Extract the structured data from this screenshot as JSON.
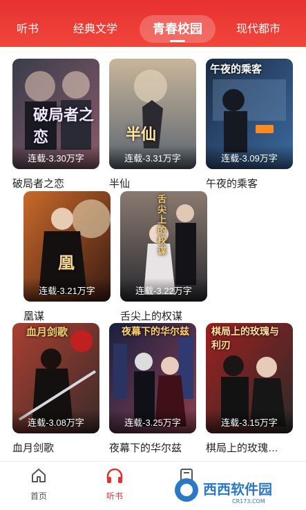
{
  "tabs": [
    {
      "label": "听书"
    },
    {
      "label": "经典文学"
    },
    {
      "label": "青春校园"
    },
    {
      "label": "现代都市"
    }
  ],
  "active_tab": "青春校园",
  "books": [
    {
      "title": "破局者之恋",
      "badge": "连载-3.30万字",
      "cover_text": "破局者之恋",
      "cover_colors": [
        "#3a3d4a",
        "#8a5a6a"
      ]
    },
    {
      "title": "半仙",
      "badge": "连载-3.31万字",
      "cover_text": "半仙",
      "cover_colors": [
        "#5a6470",
        "#c9b59a"
      ]
    },
    {
      "title": "午夜的乘客",
      "badge": "连载-3.09万字",
      "cover_text": "午夜的乘客",
      "cover_colors": [
        "#1c2c44",
        "#3b6aa0"
      ]
    },
    {
      "title": "凰谋",
      "badge": "连载-3.21万字",
      "cover_text": "凰",
      "cover_colors": [
        "#3a1a12",
        "#c96a2a"
      ]
    },
    {
      "title": "舌尖上的权谋",
      "badge": "连载-3.22万字",
      "cover_text": "舌尖上的权谋",
      "cover_colors": [
        "#2a2a30",
        "#8a7a70"
      ]
    },
    {
      "title": "血月剑歌",
      "badge": "连载-3.08万字",
      "cover_text": "血月剑歌",
      "cover_colors": [
        "#3a2a2a",
        "#a94030"
      ]
    },
    {
      "title": "夜幕下的华尔兹",
      "badge": "连载-3.25万字",
      "cover_text": "夜幕下的华尔兹",
      "cover_colors": [
        "#1a2040",
        "#8a4050"
      ]
    },
    {
      "title": "棋局上的玫瑰…",
      "badge": "连载-3.15万字",
      "cover_text": "棋局上的玫瑰与利刃",
      "cover_colors": [
        "#2a2a2a",
        "#a02020"
      ]
    }
  ],
  "bottom_nav": [
    {
      "label": "首页"
    },
    {
      "label": "听书"
    }
  ],
  "watermark": {
    "text": "西西软件园",
    "sub": "CR173.COM"
  }
}
